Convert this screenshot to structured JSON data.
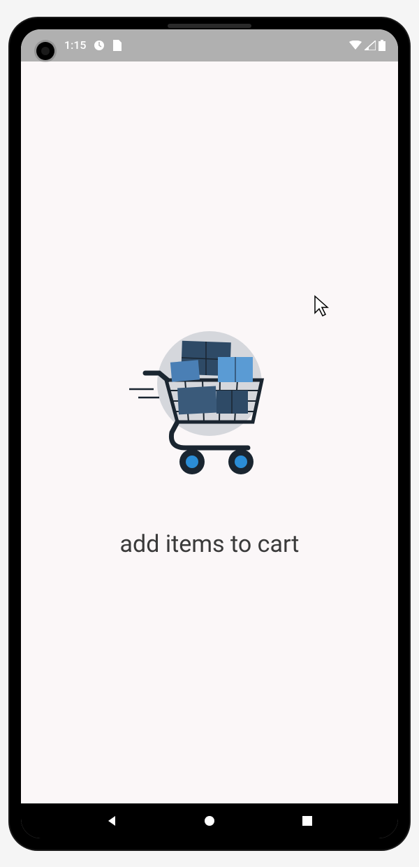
{
  "statusBar": {
    "time": "1:15"
  },
  "content": {
    "message": "add items to cart"
  },
  "colors": {
    "background": "#fbf7f8",
    "statusBar": "#b0b0b0",
    "textPrimary": "#3a3a3a",
    "accentBlue": "#2b8dd6",
    "accentDarkBlue": "#2e4a66",
    "cartDark": "#1a2530"
  }
}
